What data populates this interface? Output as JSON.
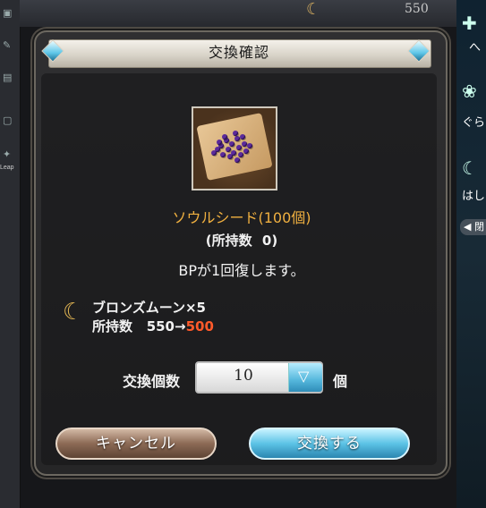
{
  "background": {
    "moon_count": "550",
    "left_bar_label": "Leap",
    "right_bar_labels": [
      "へ",
      "ぐら",
      "はし"
    ],
    "back_label": "◀ 閉"
  },
  "dialog": {
    "title": "交換確認",
    "item": {
      "name": "ソウルシード(100個)",
      "owned_label": "(所持数",
      "owned_value": "0)",
      "description": "BPが1回復します。"
    },
    "cost": {
      "currency": "ブロンズムーン×5",
      "holding_label": "所持数",
      "holding_before": "550",
      "arrow": "→",
      "holding_after": "500"
    },
    "quantity": {
      "label": "交換個数",
      "value": "10",
      "unit": "個"
    },
    "buttons": {
      "cancel": "キャンセル",
      "confirm": "交換する"
    }
  },
  "colors": {
    "item_name": "#f0b040",
    "after_value": "#ff5a2a",
    "confirm_button": "#5cc3e6",
    "cancel_button": "#8c6a55"
  },
  "icons": {
    "currency": "moon-icon",
    "title_corners": "gem-icon",
    "dropdown": "chevron-down-icon"
  }
}
